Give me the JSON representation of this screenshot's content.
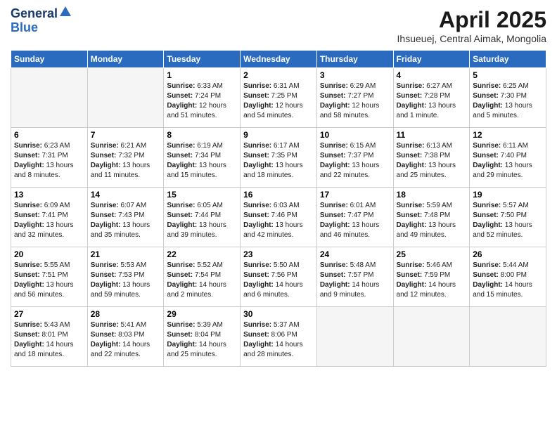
{
  "logo": {
    "line1": "General",
    "line2": "Blue"
  },
  "title": "April 2025",
  "subtitle": "Ihsueuej, Central Aimak, Mongolia",
  "days_of_week": [
    "Sunday",
    "Monday",
    "Tuesday",
    "Wednesday",
    "Thursday",
    "Friday",
    "Saturday"
  ],
  "weeks": [
    [
      {
        "day": "",
        "info": ""
      },
      {
        "day": "",
        "info": ""
      },
      {
        "day": "1",
        "info": "Sunrise: 6:33 AM\nSunset: 7:24 PM\nDaylight: 12 hours\nand 51 minutes."
      },
      {
        "day": "2",
        "info": "Sunrise: 6:31 AM\nSunset: 7:25 PM\nDaylight: 12 hours\nand 54 minutes."
      },
      {
        "day": "3",
        "info": "Sunrise: 6:29 AM\nSunset: 7:27 PM\nDaylight: 12 hours\nand 58 minutes."
      },
      {
        "day": "4",
        "info": "Sunrise: 6:27 AM\nSunset: 7:28 PM\nDaylight: 13 hours\nand 1 minute."
      },
      {
        "day": "5",
        "info": "Sunrise: 6:25 AM\nSunset: 7:30 PM\nDaylight: 13 hours\nand 5 minutes."
      }
    ],
    [
      {
        "day": "6",
        "info": "Sunrise: 6:23 AM\nSunset: 7:31 PM\nDaylight: 13 hours\nand 8 minutes."
      },
      {
        "day": "7",
        "info": "Sunrise: 6:21 AM\nSunset: 7:32 PM\nDaylight: 13 hours\nand 11 minutes."
      },
      {
        "day": "8",
        "info": "Sunrise: 6:19 AM\nSunset: 7:34 PM\nDaylight: 13 hours\nand 15 minutes."
      },
      {
        "day": "9",
        "info": "Sunrise: 6:17 AM\nSunset: 7:35 PM\nDaylight: 13 hours\nand 18 minutes."
      },
      {
        "day": "10",
        "info": "Sunrise: 6:15 AM\nSunset: 7:37 PM\nDaylight: 13 hours\nand 22 minutes."
      },
      {
        "day": "11",
        "info": "Sunrise: 6:13 AM\nSunset: 7:38 PM\nDaylight: 13 hours\nand 25 minutes."
      },
      {
        "day": "12",
        "info": "Sunrise: 6:11 AM\nSunset: 7:40 PM\nDaylight: 13 hours\nand 29 minutes."
      }
    ],
    [
      {
        "day": "13",
        "info": "Sunrise: 6:09 AM\nSunset: 7:41 PM\nDaylight: 13 hours\nand 32 minutes."
      },
      {
        "day": "14",
        "info": "Sunrise: 6:07 AM\nSunset: 7:43 PM\nDaylight: 13 hours\nand 35 minutes."
      },
      {
        "day": "15",
        "info": "Sunrise: 6:05 AM\nSunset: 7:44 PM\nDaylight: 13 hours\nand 39 minutes."
      },
      {
        "day": "16",
        "info": "Sunrise: 6:03 AM\nSunset: 7:46 PM\nDaylight: 13 hours\nand 42 minutes."
      },
      {
        "day": "17",
        "info": "Sunrise: 6:01 AM\nSunset: 7:47 PM\nDaylight: 13 hours\nand 46 minutes."
      },
      {
        "day": "18",
        "info": "Sunrise: 5:59 AM\nSunset: 7:48 PM\nDaylight: 13 hours\nand 49 minutes."
      },
      {
        "day": "19",
        "info": "Sunrise: 5:57 AM\nSunset: 7:50 PM\nDaylight: 13 hours\nand 52 minutes."
      }
    ],
    [
      {
        "day": "20",
        "info": "Sunrise: 5:55 AM\nSunset: 7:51 PM\nDaylight: 13 hours\nand 56 minutes."
      },
      {
        "day": "21",
        "info": "Sunrise: 5:53 AM\nSunset: 7:53 PM\nDaylight: 13 hours\nand 59 minutes."
      },
      {
        "day": "22",
        "info": "Sunrise: 5:52 AM\nSunset: 7:54 PM\nDaylight: 14 hours\nand 2 minutes."
      },
      {
        "day": "23",
        "info": "Sunrise: 5:50 AM\nSunset: 7:56 PM\nDaylight: 14 hours\nand 6 minutes."
      },
      {
        "day": "24",
        "info": "Sunrise: 5:48 AM\nSunset: 7:57 PM\nDaylight: 14 hours\nand 9 minutes."
      },
      {
        "day": "25",
        "info": "Sunrise: 5:46 AM\nSunset: 7:59 PM\nDaylight: 14 hours\nand 12 minutes."
      },
      {
        "day": "26",
        "info": "Sunrise: 5:44 AM\nSunset: 8:00 PM\nDaylight: 14 hours\nand 15 minutes."
      }
    ],
    [
      {
        "day": "27",
        "info": "Sunrise: 5:43 AM\nSunset: 8:01 PM\nDaylight: 14 hours\nand 18 minutes."
      },
      {
        "day": "28",
        "info": "Sunrise: 5:41 AM\nSunset: 8:03 PM\nDaylight: 14 hours\nand 22 minutes."
      },
      {
        "day": "29",
        "info": "Sunrise: 5:39 AM\nSunset: 8:04 PM\nDaylight: 14 hours\nand 25 minutes."
      },
      {
        "day": "30",
        "info": "Sunrise: 5:37 AM\nSunset: 8:06 PM\nDaylight: 14 hours\nand 28 minutes."
      },
      {
        "day": "",
        "info": ""
      },
      {
        "day": "",
        "info": ""
      },
      {
        "day": "",
        "info": ""
      }
    ]
  ]
}
